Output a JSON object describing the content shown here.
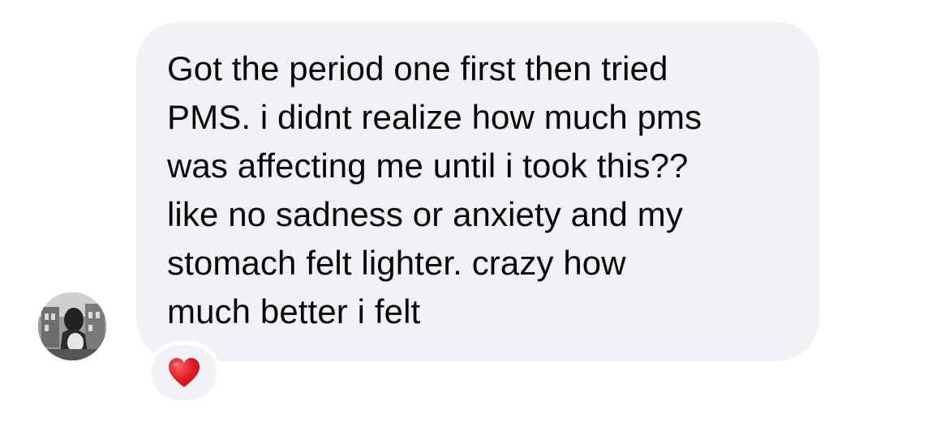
{
  "message": {
    "text": "Got the period one first then tried\nPMS. i didnt realize how much pms\nwas affecting me until i took this??\nlike no sadness or anxiety and my\nstomach felt lighter. crazy how\nmuch better i felt",
    "bubble_color": "#f1f2f5",
    "text_color": "#050505"
  },
  "sender": {
    "avatar_icon": "avatar-photo"
  },
  "reaction": {
    "icon": "red-heart-icon",
    "color": "#e31b23"
  }
}
